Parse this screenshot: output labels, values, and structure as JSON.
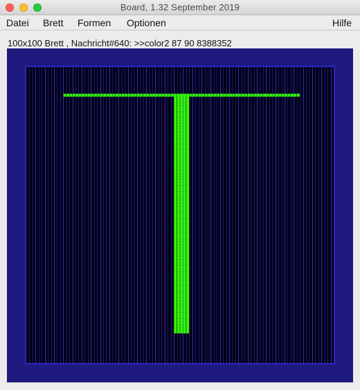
{
  "window": {
    "title": "Board, 1.32   September 2019"
  },
  "menu": {
    "items": [
      "Datei",
      "Brett",
      "Formen",
      "Optionen"
    ],
    "help": "Hilfe"
  },
  "status": {
    "text": "100x100 Brett , Nachricht#640: >>color2 87 90 8388352"
  },
  "board": {
    "columns": 100,
    "rows": 100,
    "background_color": "#1f1a7e",
    "grid_color": "#020019",
    "line_color": "#1c1a6e",
    "line_color_alt": "#3532a8",
    "active_color": "#33ff00",
    "top_bar": {
      "row": 9,
      "col_from": 12,
      "col_to": 88
    },
    "stem": {
      "col_from": 48,
      "col_to": 52,
      "row_from": 9,
      "row_to": 89
    }
  }
}
